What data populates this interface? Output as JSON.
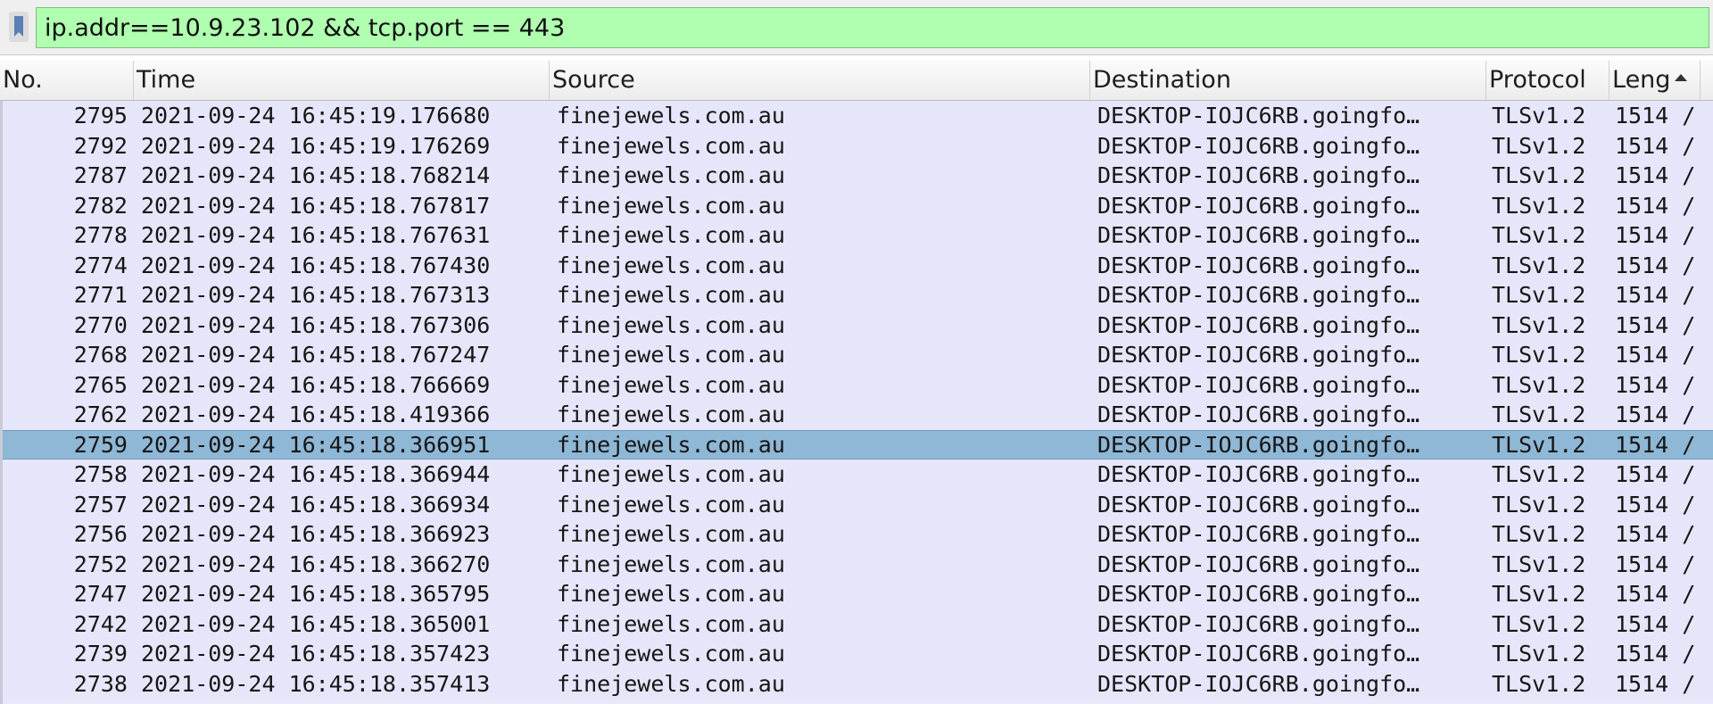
{
  "filter": {
    "value": "ip.addr==10.9.23.102 && tcp.port == 443"
  },
  "columns": [
    {
      "label": "No."
    },
    {
      "label": "Time"
    },
    {
      "label": "Source"
    },
    {
      "label": "Destination"
    },
    {
      "label": "Protocol"
    },
    {
      "label": "Leng"
    }
  ],
  "sort_indicator": "ascending",
  "packets": [
    {
      "no": "2795",
      "time": "2021-09-24 16:45:19.176680",
      "source": "finejewels.com.au",
      "destination": "DESKTOP-IOJC6RB.goingfo…",
      "protocol": "TLSv1.2",
      "length": "1514 /"
    },
    {
      "no": "2792",
      "time": "2021-09-24 16:45:19.176269",
      "source": "finejewels.com.au",
      "destination": "DESKTOP-IOJC6RB.goingfo…",
      "protocol": "TLSv1.2",
      "length": "1514 /"
    },
    {
      "no": "2787",
      "time": "2021-09-24 16:45:18.768214",
      "source": "finejewels.com.au",
      "destination": "DESKTOP-IOJC6RB.goingfo…",
      "protocol": "TLSv1.2",
      "length": "1514 /"
    },
    {
      "no": "2782",
      "time": "2021-09-24 16:45:18.767817",
      "source": "finejewels.com.au",
      "destination": "DESKTOP-IOJC6RB.goingfo…",
      "protocol": "TLSv1.2",
      "length": "1514 /"
    },
    {
      "no": "2778",
      "time": "2021-09-24 16:45:18.767631",
      "source": "finejewels.com.au",
      "destination": "DESKTOP-IOJC6RB.goingfo…",
      "protocol": "TLSv1.2",
      "length": "1514 /"
    },
    {
      "no": "2774",
      "time": "2021-09-24 16:45:18.767430",
      "source": "finejewels.com.au",
      "destination": "DESKTOP-IOJC6RB.goingfo…",
      "protocol": "TLSv1.2",
      "length": "1514 /"
    },
    {
      "no": "2771",
      "time": "2021-09-24 16:45:18.767313",
      "source": "finejewels.com.au",
      "destination": "DESKTOP-IOJC6RB.goingfo…",
      "protocol": "TLSv1.2",
      "length": "1514 /"
    },
    {
      "no": "2770",
      "time": "2021-09-24 16:45:18.767306",
      "source": "finejewels.com.au",
      "destination": "DESKTOP-IOJC6RB.goingfo…",
      "protocol": "TLSv1.2",
      "length": "1514 /"
    },
    {
      "no": "2768",
      "time": "2021-09-24 16:45:18.767247",
      "source": "finejewels.com.au",
      "destination": "DESKTOP-IOJC6RB.goingfo…",
      "protocol": "TLSv1.2",
      "length": "1514 /"
    },
    {
      "no": "2765",
      "time": "2021-09-24 16:45:18.766669",
      "source": "finejewels.com.au",
      "destination": "DESKTOP-IOJC6RB.goingfo…",
      "protocol": "TLSv1.2",
      "length": "1514 /"
    },
    {
      "no": "2762",
      "time": "2021-09-24 16:45:18.419366",
      "source": "finejewels.com.au",
      "destination": "DESKTOP-IOJC6RB.goingfo…",
      "protocol": "TLSv1.2",
      "length": "1514 /"
    },
    {
      "no": "2759",
      "time": "2021-09-24 16:45:18.366951",
      "source": "finejewels.com.au",
      "destination": "DESKTOP-IOJC6RB.goingfo…",
      "protocol": "TLSv1.2",
      "length": "1514 /",
      "selected": true
    },
    {
      "no": "2758",
      "time": "2021-09-24 16:45:18.366944",
      "source": "finejewels.com.au",
      "destination": "DESKTOP-IOJC6RB.goingfo…",
      "protocol": "TLSv1.2",
      "length": "1514 /"
    },
    {
      "no": "2757",
      "time": "2021-09-24 16:45:18.366934",
      "source": "finejewels.com.au",
      "destination": "DESKTOP-IOJC6RB.goingfo…",
      "protocol": "TLSv1.2",
      "length": "1514 /"
    },
    {
      "no": "2756",
      "time": "2021-09-24 16:45:18.366923",
      "source": "finejewels.com.au",
      "destination": "DESKTOP-IOJC6RB.goingfo…",
      "protocol": "TLSv1.2",
      "length": "1514 /"
    },
    {
      "no": "2752",
      "time": "2021-09-24 16:45:18.366270",
      "source": "finejewels.com.au",
      "destination": "DESKTOP-IOJC6RB.goingfo…",
      "protocol": "TLSv1.2",
      "length": "1514 /"
    },
    {
      "no": "2747",
      "time": "2021-09-24 16:45:18.365795",
      "source": "finejewels.com.au",
      "destination": "DESKTOP-IOJC6RB.goingfo…",
      "protocol": "TLSv1.2",
      "length": "1514 /"
    },
    {
      "no": "2742",
      "time": "2021-09-24 16:45:18.365001",
      "source": "finejewels.com.au",
      "destination": "DESKTOP-IOJC6RB.goingfo…",
      "protocol": "TLSv1.2",
      "length": "1514 /"
    },
    {
      "no": "2739",
      "time": "2021-09-24 16:45:18.357423",
      "source": "finejewels.com.au",
      "destination": "DESKTOP-IOJC6RB.goingfo…",
      "protocol": "TLSv1.2",
      "length": "1514 /"
    },
    {
      "no": "2738",
      "time": "2021-09-24 16:45:18.357413",
      "source": "finejewels.com.au",
      "destination": "DESKTOP-IOJC6RB.goingfo…",
      "protocol": "TLSv1.2",
      "length": "1514 /"
    }
  ],
  "icons": {
    "bookmark": "bookmark-icon",
    "sort": "sort-ascending-icon"
  },
  "colors": {
    "filter_valid": "#b0ffb0",
    "row_background": "#e6e6fa",
    "row_selected": "#8fb7d6"
  }
}
